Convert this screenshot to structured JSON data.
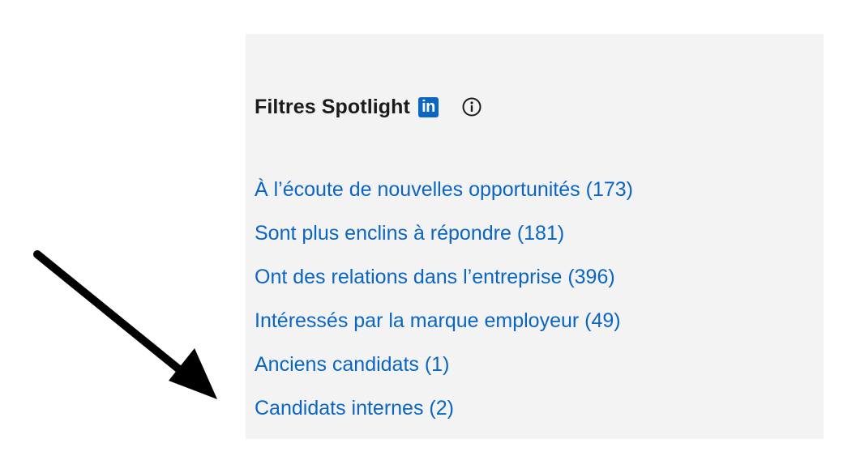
{
  "panel": {
    "title": "Filtres Spotlight",
    "badge_text": "in",
    "brand_color": "#0a66c2",
    "info_icon": "info-circle-icon"
  },
  "filters": [
    {
      "label": "À l’écoute de nouvelles opportunités",
      "count": "(173)"
    },
    {
      "label": "Sont plus enclins à répondre",
      "count": "(181)"
    },
    {
      "label": "Ont des relations dans l’entreprise",
      "count": "(396)"
    },
    {
      "label": "Intéressés par la marque employeur",
      "count": "(49)"
    },
    {
      "label": "Anciens candidats",
      "count": "(1)"
    },
    {
      "label": "Candidats internes",
      "count": "(2)"
    }
  ],
  "annotation": {
    "icon": "arrow-icon",
    "points_to": "Candidats internes",
    "color": "#000000"
  }
}
